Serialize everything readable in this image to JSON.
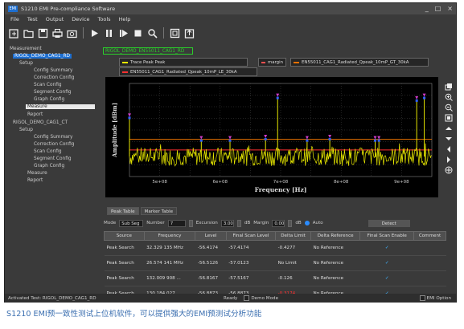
{
  "window": {
    "title": "S1210 EMI Pre-compliance Software",
    "controls": [
      "_",
      "□",
      "×"
    ]
  },
  "menu": [
    "File",
    "Test",
    "Output",
    "Device",
    "Tools",
    "Help"
  ],
  "toolbar": {
    "icons": [
      "new-test-icon",
      "open-folder-icon",
      "save-icon",
      "print-icon",
      "camera-icon",
      "play-icon",
      "pause-icon",
      "step-icon",
      "stop-icon",
      "search-icon",
      "window-icon",
      "export-icon"
    ]
  },
  "sidebar": {
    "root": "Measurement",
    "projects": [
      {
        "name": "RIGOL_DEMO_CAG1_RD",
        "selected": true,
        "setup": "Setup",
        "items": [
          "Config Summary",
          "Correction Config",
          "Scan Config",
          "Segment Config",
          "Graph Config"
        ],
        "measure": "Measure",
        "report": "Report"
      },
      {
        "name": "RIGOL_DEMO_CAG1_CT",
        "selected": false,
        "setup": "Setup",
        "items": [
          "Config Summary",
          "Correction Config",
          "Scan Config",
          "Segment Config",
          "Graph Config"
        ],
        "measure": "Measure",
        "report": "Report"
      }
    ]
  },
  "device_tab": "RIGOL_DEMO_EN55011_CAG1_RD",
  "legend": [
    {
      "label": "Trace Peak Peak",
      "color": "#e8e800"
    },
    {
      "label": "margin",
      "color": "#ff5050"
    },
    {
      "label": "EN55011_CAG1_Radiated_Qpeak_10mP_GT_30kA",
      "color": "#e87000"
    },
    {
      "label": "EN55011_CAG1_Radiated_Qpeak_10mP_LE_30kA",
      "color": "#ff3030"
    }
  ],
  "chart_data": {
    "type": "line",
    "xlabel": "Frequency [Hz]",
    "ylabel": "Amplitude [dBm]",
    "x_ticks": [
      "5e+08",
      "6e+08",
      "7e+08",
      "8e+08",
      "9e+08"
    ],
    "xlim": [
      500000000,
      900000000
    ],
    "noise_floor": -65,
    "limit_lines": [
      {
        "name": "upper",
        "y": -52,
        "color": "#e87000"
      },
      {
        "name": "lower",
        "y": -60,
        "color": "#ff3030"
      }
    ],
    "peaks": [
      {
        "x": 500000000,
        "y": -35
      },
      {
        "x": 595000000,
        "y": -52
      },
      {
        "x": 633000000,
        "y": -52
      },
      {
        "x": 680000000,
        "y": -51
      },
      {
        "x": 696000000,
        "y": -20
      },
      {
        "x": 735000000,
        "y": -52
      },
      {
        "x": 765000000,
        "y": -51
      },
      {
        "x": 825000000,
        "y": -52
      },
      {
        "x": 830000000,
        "y": -52
      },
      {
        "x": 880000000,
        "y": -22
      },
      {
        "x": 890000000,
        "y": -20
      }
    ],
    "grid": true
  },
  "panel_tabs": [
    "Peak Table",
    "Marker Table"
  ],
  "controls": {
    "mode_label": "Mode",
    "mode_value": "Sub Seg",
    "number_label": "Number",
    "number_value": "7",
    "excursion_label": "Excursion",
    "excursion_value": "3.00",
    "excursion_unit": "dB",
    "margin_label": "Margin",
    "margin_value": "0.00",
    "margin_unit": "dB",
    "auto_label": "Auto",
    "detect_label": "Detect"
  },
  "table": {
    "headers": [
      "Source",
      "Frequency",
      "Level",
      "Final Scan Level",
      "Delta Limit",
      "Delta Reference",
      "Final Scan Enable",
      "Comment"
    ],
    "rows": [
      [
        "Peak Search",
        "32.329 135 MHz",
        "-56.4174",
        "-57.4174",
        "-0.4277",
        "No Reference",
        "✓",
        ""
      ],
      [
        "Peak Search",
        "26.574 141 MHz",
        "-56.5126",
        "-57.0123",
        "No Limit",
        "No Reference",
        "✓",
        ""
      ],
      [
        "Peak Search",
        "132.009 908 ...",
        "-56.8167",
        "-57.5167",
        "-0.126",
        "No Reference",
        "✓",
        ""
      ],
      [
        "Peak Search",
        "130.184 027 ...",
        "-56.8873",
        "-56.8873",
        "-0.3174",
        "No Reference",
        "✓",
        ""
      ]
    ]
  },
  "status": {
    "left": "Activated Test: RIGOL_DEMO_CAG1_RD",
    "ready": "Ready",
    "demo_mode": "Demo Mode",
    "emi_option": "EMI Option"
  },
  "caption": "S1210 EMI预一致性测试上位机软件，可以提供强大的EMI预测试分析功能"
}
